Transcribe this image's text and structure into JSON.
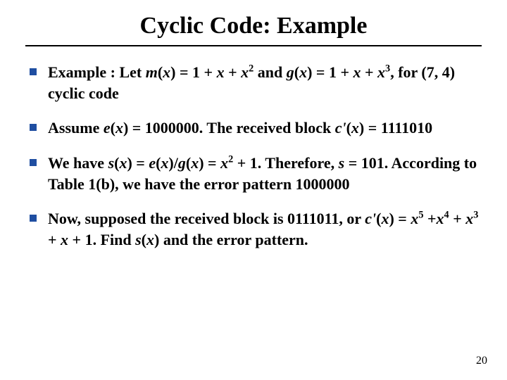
{
  "title": "Cyclic Code: Example",
  "bullets": [
    {
      "html": "Example : Let <i>m</i>(<i>x</i>) = 1 + <i>x</i> + <i>x</i><sup>2</sup> and <i>g</i>(<i>x</i>) = 1 + <i>x</i> + <i>x</i><sup>3</sup>, for (7, 4) cyclic code"
    },
    {
      "html": "Assume <i>e</i>(<i>x</i>) = 1000000. The received block <i>c'</i>(<i>x</i>) = 1111010"
    },
    {
      "html": "We have <i>s</i>(<i>x</i>) = <i>e</i>(<i>x</i>)/<i>g</i>(<i>x</i>) = <i>x</i><sup>2</sup> + 1. Therefore, <i>s</i> = 101. According to Table 1(b), we have the error pattern 1000000"
    },
    {
      "html": "Now, supposed the received block is 0111011, or <i>c'</i>(<i>x</i>) = <i>x</i><sup>5</sup> +<i>x</i><sup>4</sup> + <i>x</i><sup>3</sup> + <i>x</i> + 1. Find <i>s</i>(<i>x</i>) and the error pattern."
    }
  ],
  "page_number": "20"
}
